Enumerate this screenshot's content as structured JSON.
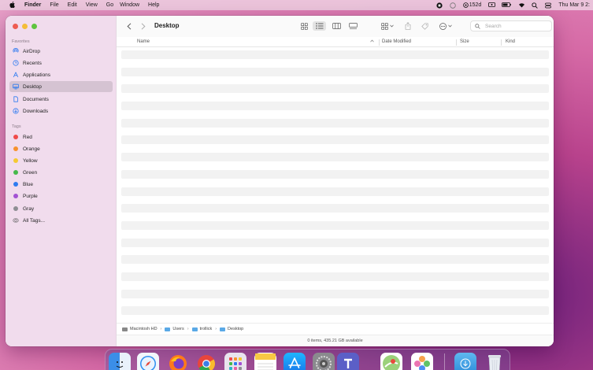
{
  "menubar": {
    "app_name": "Finder",
    "items": [
      "File",
      "Edit",
      "View",
      "Go",
      "Window",
      "Help"
    ],
    "battery_text": "152d",
    "clock": "Thu Mar 9 2:"
  },
  "window": {
    "title": "Desktop",
    "search_placeholder": "Search"
  },
  "sidebar": {
    "favorites_header": "Favorites",
    "favorites": [
      {
        "label": "AirDrop",
        "icon": "airdrop-icon"
      },
      {
        "label": "Recents",
        "icon": "clock-icon"
      },
      {
        "label": "Applications",
        "icon": "applications-icon"
      },
      {
        "label": "Desktop",
        "icon": "desktop-icon",
        "active": true
      },
      {
        "label": "Documents",
        "icon": "document-icon"
      },
      {
        "label": "Downloads",
        "icon": "download-icon"
      }
    ],
    "tags_header": "Tags",
    "tags": [
      {
        "label": "Red",
        "color": "#f04a4a"
      },
      {
        "label": "Orange",
        "color": "#f7922e"
      },
      {
        "label": "Yellow",
        "color": "#f5c932"
      },
      {
        "label": "Green",
        "color": "#46b94b"
      },
      {
        "label": "Blue",
        "color": "#2f7bf0"
      },
      {
        "label": "Purple",
        "color": "#a352d3"
      },
      {
        "label": "Gray",
        "color": "#8e8e93"
      }
    ],
    "all_tags": "All Tags..."
  },
  "columns": {
    "name": "Name",
    "date_modified": "Date Modified",
    "size": "Size",
    "kind": "Kind"
  },
  "pathbar": {
    "segments": [
      "Macintosh HD",
      "Users",
      "trollick",
      "Desktop"
    ]
  },
  "status": {
    "text": "0 items, 435.21 GB available"
  },
  "dock": {
    "apps": [
      "finder-icon",
      "safari-icon",
      "firefox-icon",
      "chrome-icon",
      "launchpad-icon",
      "notes-icon",
      "app-store-icon",
      "system-preferences-icon",
      "teams-icon",
      "maps-icon",
      "photos-icon",
      "downloads-folder-icon",
      "trash-icon"
    ]
  },
  "colors": {
    "accent": "#2f7bf0",
    "folder": "#5aa9e6"
  }
}
